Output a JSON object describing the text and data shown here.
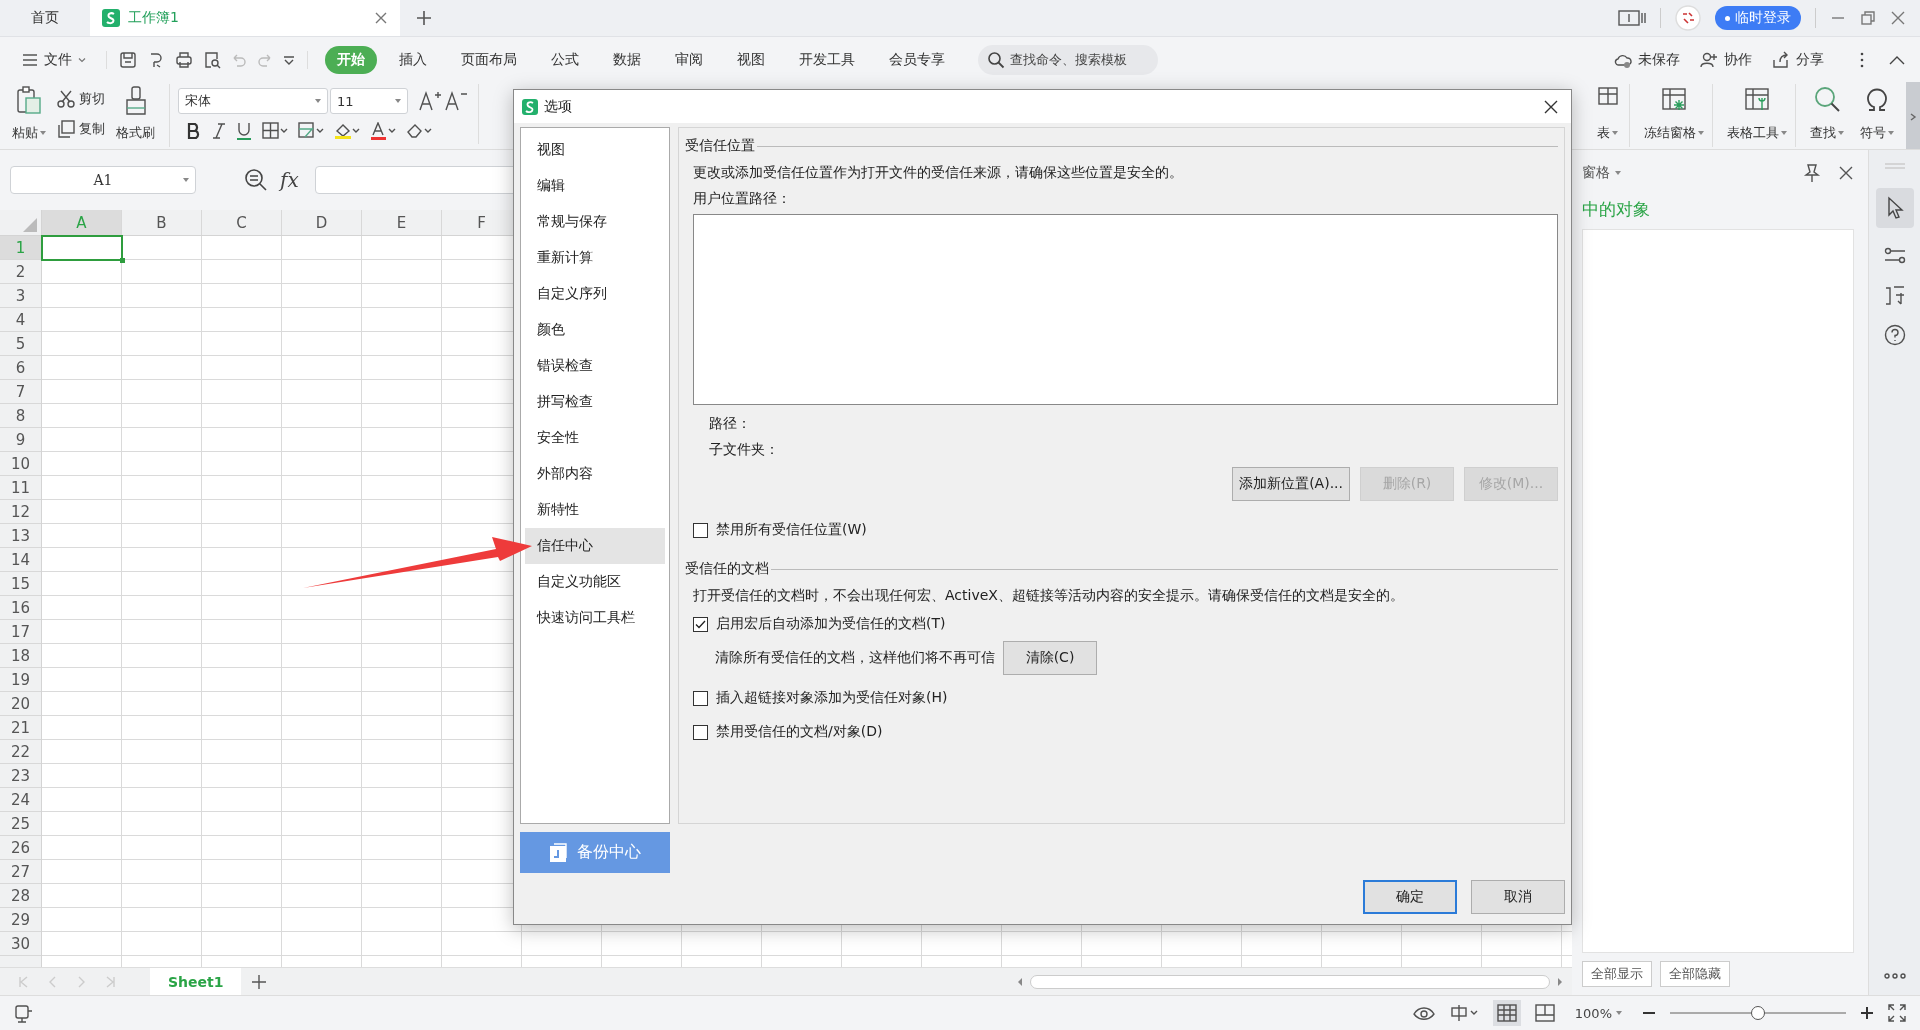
{
  "tabs": [
    {
      "kind": "home",
      "label": "首页",
      "selected": false
    },
    {
      "kind": "document",
      "label": "工作簿1",
      "selected": true
    }
  ],
  "account": {
    "login": "临时登录"
  },
  "menu": {
    "file": "文件",
    "tabs": [
      {
        "label": "开始",
        "selected": true
      },
      {
        "label": "插入",
        "selected": false
      },
      {
        "label": "页面布局",
        "selected": false
      },
      {
        "label": "公式",
        "selected": false
      },
      {
        "label": "数据",
        "selected": false
      },
      {
        "label": "审阅",
        "selected": false
      },
      {
        "label": "视图",
        "selected": false
      },
      {
        "label": "开发工具",
        "selected": false
      },
      {
        "label": "会员专享",
        "selected": false
      }
    ],
    "search": {
      "placeholder": "查找命令、搜索模板"
    },
    "actions": [
      "未保存",
      "协作",
      "分享"
    ]
  },
  "ribbon": {
    "clipboard": [
      "粘贴",
      "剪切",
      "复制",
      "格式刷"
    ],
    "font": "宋体",
    "size": "11",
    "tools": [
      "表",
      "冻结窗格",
      "表格工具",
      "查找",
      "符号"
    ]
  },
  "formula_bar": {
    "cell": "A1",
    "fx": "fx"
  },
  "sheet": {
    "columns": [
      {
        "label": "A",
        "selected": true
      },
      {
        "label": "B",
        "selected": false
      },
      {
        "label": "C",
        "selected": false
      },
      {
        "label": "D",
        "selected": false
      },
      {
        "label": "E",
        "selected": false
      },
      {
        "label": "F",
        "selected": false
      }
    ],
    "rows": [
      {
        "label": "1",
        "selected": true
      },
      {
        "label": "2",
        "selected": false
      },
      {
        "label": "3",
        "selected": false
      },
      {
        "label": "4",
        "selected": false
      },
      {
        "label": "5",
        "selected": false
      },
      {
        "label": "6",
        "selected": false
      },
      {
        "label": "7",
        "selected": false
      },
      {
        "label": "8",
        "selected": false
      },
      {
        "label": "9",
        "selected": false
      },
      {
        "label": "10",
        "selected": false
      },
      {
        "label": "11",
        "selected": false
      },
      {
        "label": "12",
        "selected": false
      },
      {
        "label": "13",
        "selected": false
      },
      {
        "label": "14",
        "selected": false
      },
      {
        "label": "15",
        "selected": false
      },
      {
        "label": "16",
        "selected": false
      },
      {
        "label": "17",
        "selected": false
      },
      {
        "label": "18",
        "selected": false
      },
      {
        "label": "19",
        "selected": false
      },
      {
        "label": "20",
        "selected": false
      },
      {
        "label": "21",
        "selected": false
      },
      {
        "label": "22",
        "selected": false
      },
      {
        "label": "23",
        "selected": false
      },
      {
        "label": "24",
        "selected": false
      },
      {
        "label": "25",
        "selected": false
      },
      {
        "label": "26",
        "selected": false
      },
      {
        "label": "27",
        "selected": false
      },
      {
        "label": "28",
        "selected": false
      },
      {
        "label": "29",
        "selected": false
      },
      {
        "label": "30",
        "selected": false
      }
    ]
  },
  "sheet_tabs": [
    {
      "label": "Sheet1",
      "selected": true
    }
  ],
  "task_pane": {
    "title": "窗格",
    "heading": "中的对象",
    "buttons": [
      "全部显示",
      "全部隐藏"
    ]
  },
  "status": {
    "zoom": "100%",
    "level": 0.5
  },
  "dialog": {
    "title": "选项",
    "nav": [
      {
        "label": "视图",
        "selected": false
      },
      {
        "label": "编辑",
        "selected": false
      },
      {
        "label": "常规与保存",
        "selected": false
      },
      {
        "label": "重新计算",
        "selected": false
      },
      {
        "label": "自定义序列",
        "selected": false
      },
      {
        "label": "颜色",
        "selected": false
      },
      {
        "label": "错误检查",
        "selected": false
      },
      {
        "label": "拼写检查",
        "selected": false
      },
      {
        "label": "安全性",
        "selected": false
      },
      {
        "label": "外部内容",
        "selected": false
      },
      {
        "label": "新特性",
        "selected": false
      },
      {
        "label": "信任中心",
        "selected": true
      },
      {
        "label": "自定义功能区",
        "selected": false
      },
      {
        "label": "快速访问工具栏",
        "selected": false
      }
    ],
    "backup": "备份中心",
    "locations": {
      "title": "受信任位置",
      "description": "更改或添加受信任位置作为打开文件的受信任来源，请确保这些位置是安全的。",
      "list_label": "用户位置路径：",
      "path_label": "路径：",
      "subfolder_label": "子文件夹：",
      "buttons": [
        {
          "label": "添加新位置(A)...",
          "disabled": false
        },
        {
          "label": "删除(R)",
          "disabled": true
        },
        {
          "label": "修改(M)...",
          "disabled": true
        }
      ],
      "disable_all": {
        "label": "禁用所有受信任位置(W)",
        "checked": false
      }
    },
    "documents": {
      "title": "受信任的文档",
      "description": "打开受信任的文档时，不会出现任何宏、ActiveX、超链接等活动内容的安全提示。请确保受信任的文档是安全的。",
      "options": [
        {
          "kind": "checkbox",
          "label": "启用宏后自动添加为受信任的文档(T)",
          "checked": true
        },
        {
          "kind": "action",
          "label": "清除所有受信任的文档，这样他们将不再可信",
          "button": "清除(C)"
        },
        {
          "kind": "checkbox",
          "label": "插入超链接对象添加为受信任对象(H)",
          "checked": false
        },
        {
          "kind": "checkbox",
          "label": "禁用受信任的文档/对象(D)",
          "checked": false
        }
      ]
    },
    "buttons": [
      {
        "label": "确定",
        "default": true
      },
      {
        "label": "取消",
        "default": false
      }
    ]
  }
}
